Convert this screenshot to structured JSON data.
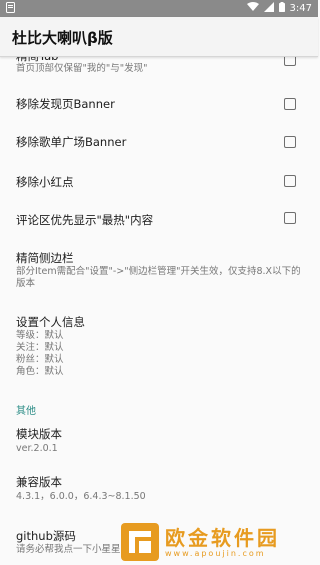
{
  "status": {
    "time": "3:47"
  },
  "app": {
    "title": "杜比大喇叭β版"
  },
  "items": [
    {
      "title": "精简Tab",
      "subtitle": "首页顶部仅保留\"我的\"与\"发现\""
    },
    {
      "title": "移除发现页Banner"
    },
    {
      "title": "移除歌单广场Banner"
    },
    {
      "title": "移除小红点"
    },
    {
      "title": "评论区优先显示\"最热\"内容"
    },
    {
      "title": "精简侧边栏",
      "subtitle": "部分Item需配合\"设置\"->\"侧边栏管理\"开关生效，仅支持8.X以下的版本"
    },
    {
      "title": "设置个人信息",
      "lines": [
        "等级：默认",
        "关注：默认",
        "粉丝：默认",
        "角色：默认"
      ]
    }
  ],
  "section_other": "其他",
  "other": [
    {
      "title": "模块版本",
      "subtitle": "ver.2.0.1"
    },
    {
      "title": "兼容版本",
      "subtitle": "4.3.1，6.0.0，6.4.3~8.1.50"
    },
    {
      "title": "github源码",
      "subtitle": "请务必帮我点一下小星星"
    }
  ],
  "watermark": {
    "name": "欧金软件园",
    "url": "www.apoujin.com"
  }
}
